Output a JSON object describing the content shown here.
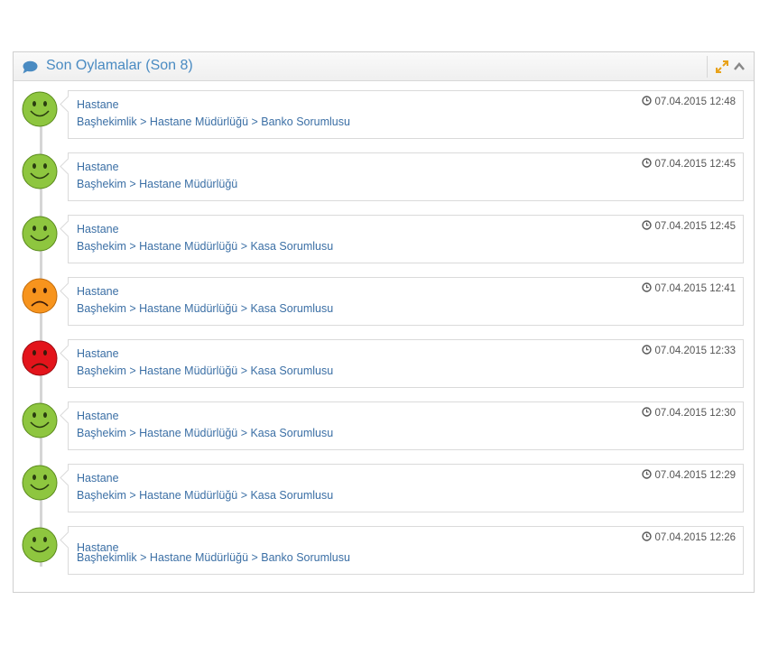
{
  "panel": {
    "title": "Son Oylamalar (Son 8)",
    "icon": "comment-icon",
    "accent": "#4a8bc2"
  },
  "votes": [
    {
      "mood": "happy",
      "color": "#8ec63f",
      "place": "Hastane",
      "path": "Başhekimlik > Hastane Müdürlüğü > Banko Sorumlusu",
      "time": "07.04.2015 12:48"
    },
    {
      "mood": "happy",
      "color": "#8ec63f",
      "place": "Hastane",
      "path": "Başhekim > Hastane Müdürlüğü",
      "time": "07.04.2015 12:45"
    },
    {
      "mood": "happy",
      "color": "#8ec63f",
      "place": "Hastane",
      "path": "Başhekim > Hastane Müdürlüğü > Kasa Sorumlusu",
      "time": "07.04.2015 12:45"
    },
    {
      "mood": "sad",
      "color": "#f7941d",
      "place": "Hastane",
      "path": "Başhekim > Hastane Müdürlüğü > Kasa Sorumlusu",
      "time": "07.04.2015 12:41"
    },
    {
      "mood": "sad",
      "color": "#e3141b",
      "place": "Hastane",
      "path": "Başhekim > Hastane Müdürlüğü > Kasa Sorumlusu",
      "time": "07.04.2015 12:33"
    },
    {
      "mood": "happy",
      "color": "#8ec63f",
      "place": "Hastane",
      "path": "Başhekim > Hastane Müdürlüğü > Kasa Sorumlusu",
      "time": "07.04.2015 12:30"
    },
    {
      "mood": "happy",
      "color": "#8ec63f",
      "place": "Hastane",
      "path": "Başhekim > Hastane Müdürlüğü > Kasa Sorumlusu",
      "time": "07.04.2015 12:29"
    },
    {
      "mood": "happy",
      "color": "#8ec63f",
      "place": "Hastane",
      "path": "Başhekimlik > Hastane Müdürlüğü > Banko Sorumlusu",
      "time": "07.04.2015 12:26"
    }
  ]
}
